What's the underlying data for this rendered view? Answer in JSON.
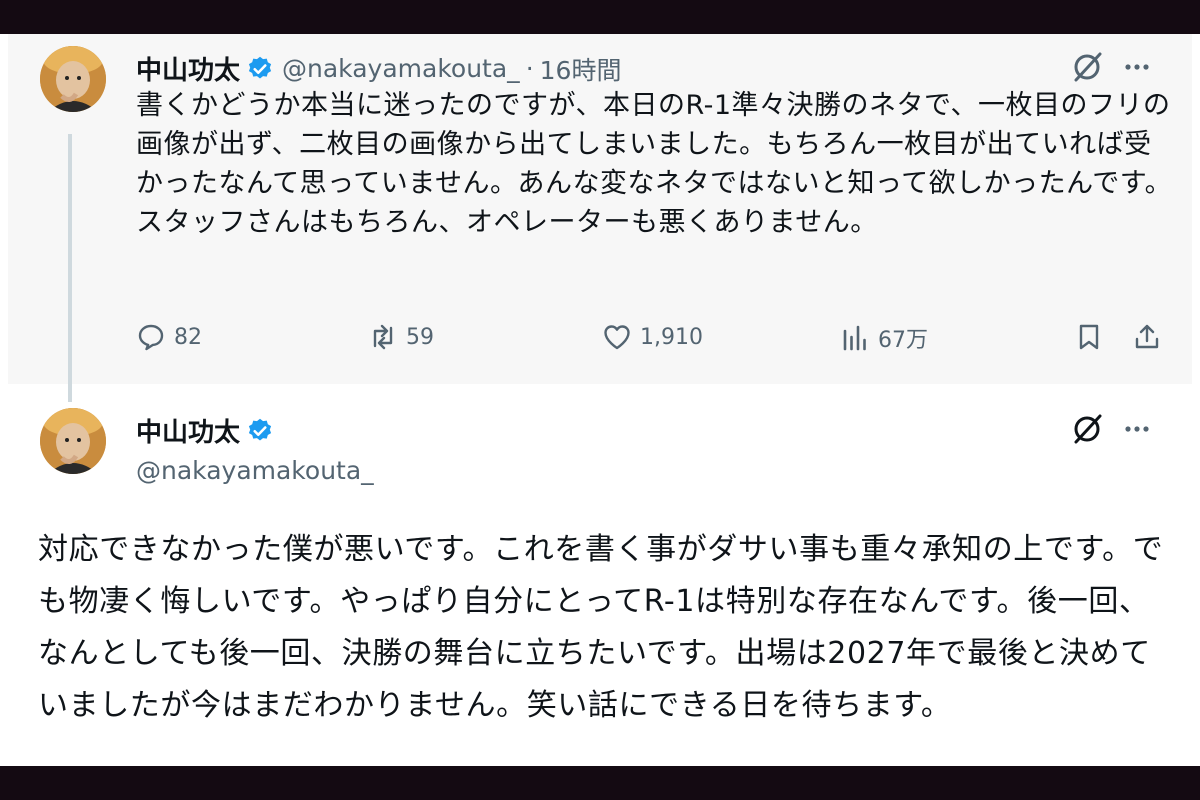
{
  "tweet1": {
    "name": "中山功太",
    "handle": "@nakayamakouta_",
    "separator": "·",
    "time": "16時間",
    "text": "書くかどうか本当に迷ったのですが、本日のR-1準々決勝のネタで、一枚目のフリの画像が出ず、二枚目の画像から出てしまいました。もちろん一枚目が出ていれば受かったなんて思っていません。あんな変なネタではないと知って欲しかったんです。スタッフさんはもちろん、オペレーターも悪くありません。",
    "actions": {
      "replies": "82",
      "reposts": "59",
      "likes": "1,910",
      "views": "67万"
    }
  },
  "tweet2": {
    "name": "中山功太",
    "handle": "@nakayamakouta_",
    "text": "対応できなかった僕が悪いです。これを書く事がダサい事も重々承知の上です。でも物凄く悔しいです。やっぱり自分にとってR-1は特別な存在なんです。後一回、なんとしても後一回、決勝の舞台に立ちたいです。出場は2027年で最後と決めていましたが今はまだわかりません。笑い話にできる日を待ちます。"
  },
  "colors": {
    "verified": "#1d9bf0",
    "muted": "#536471",
    "text": "#0f1419",
    "border_band": "#140a12"
  },
  "icons": [
    "verified-badge-icon",
    "grok-slash-icon",
    "more-icon",
    "reply-icon",
    "repost-icon",
    "like-icon",
    "views-icon",
    "bookmark-icon",
    "share-icon"
  ]
}
